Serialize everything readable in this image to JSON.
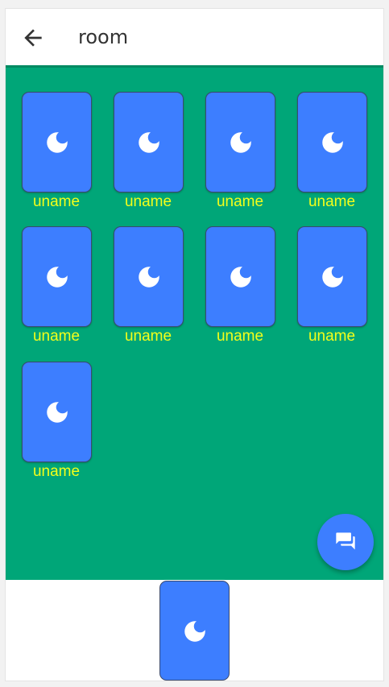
{
  "appbar": {
    "title": "room",
    "back_icon": "arrow-left-icon"
  },
  "table": {
    "background": "#00a678",
    "card_color": "#3d7eff",
    "name_color": "#f4ff1a",
    "card_icon": "moon-icon",
    "players": [
      {
        "name": "uname"
      },
      {
        "name": "uname"
      },
      {
        "name": "uname"
      },
      {
        "name": "uname"
      },
      {
        "name": "uname"
      },
      {
        "name": "uname"
      },
      {
        "name": "uname"
      },
      {
        "name": "uname"
      },
      {
        "name": "uname"
      }
    ]
  },
  "chat_button": {
    "icon": "chat-icon"
  },
  "hand": {
    "card_icon": "moon-icon"
  }
}
